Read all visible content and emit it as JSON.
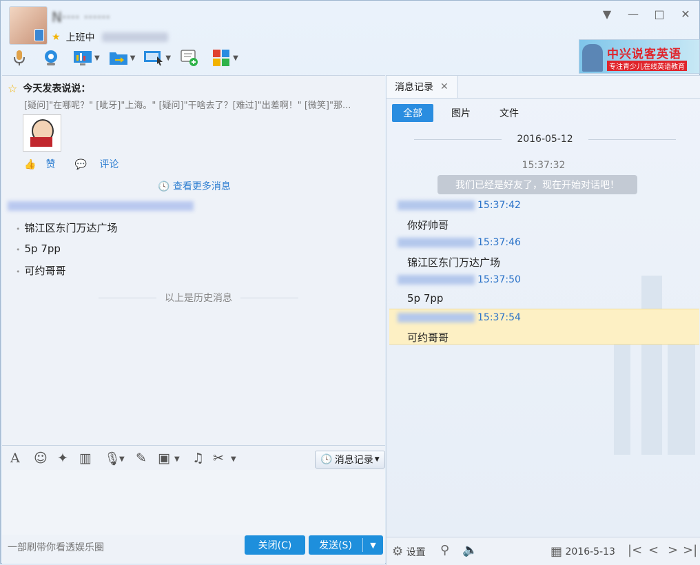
{
  "header": {
    "contact_name": "N···· ······",
    "status": "上班中",
    "window_controls": [
      "dropdown-icon",
      "minimize-icon",
      "maximize-icon",
      "close-icon"
    ],
    "toolbar_icons": [
      "microphone-icon",
      "webcam-icon",
      "screen-share-icon",
      "file-transfer-icon",
      "remote-desktop-icon",
      "group-chat-icon",
      "apps-icon"
    ],
    "ad": {
      "title": "中兴说客英语",
      "subtitle": "专注青少儿在线英语教育"
    }
  },
  "feed": {
    "heading": "今天发表说说：",
    "text": "[疑问]\"在哪呢？\" [呲牙]\"上海。\" [疑问]\"干啥去了？[难过]\"出差啊！\" [微笑]\"那...",
    "like_label": "赞",
    "comment_label": "评论",
    "more_label": "查看更多消息"
  },
  "history": {
    "messages": [
      "锦江区东门万达广场",
      "5p  7pp",
      "可约哥哥"
    ],
    "divider": "以上是历史消息"
  },
  "input_toolbar": {
    "icons": [
      "font-icon",
      "emoji-icon",
      "nudge-icon",
      "video-clip-icon",
      "voice-icon",
      "edit-icon",
      "image-icon",
      "music-icon",
      "scissors-icon"
    ],
    "history_button": "消息记录"
  },
  "bottom": {
    "ad_text": "一部刷带你看透娱乐圈",
    "close_label": "关闭(C)",
    "send_label": "发送(S)"
  },
  "record": {
    "tab_label": "消息记录",
    "filters": [
      "全部",
      "图片",
      "文件"
    ],
    "date": "2016-05-12",
    "first_time": "15:37:32",
    "system_msg": "我们已经是好友了，现在开始对话吧！",
    "messages": [
      {
        "time": "15:37:42",
        "text": "你好帅哥"
      },
      {
        "time": "15:37:46",
        "text": "锦江区东门万达广场"
      },
      {
        "time": "15:37:50",
        "text": "5p  7pp"
      },
      {
        "time": "15:37:54",
        "text": "可约哥哥"
      }
    ],
    "settings_label": "设置",
    "date_bottom": "2016-5-13"
  }
}
